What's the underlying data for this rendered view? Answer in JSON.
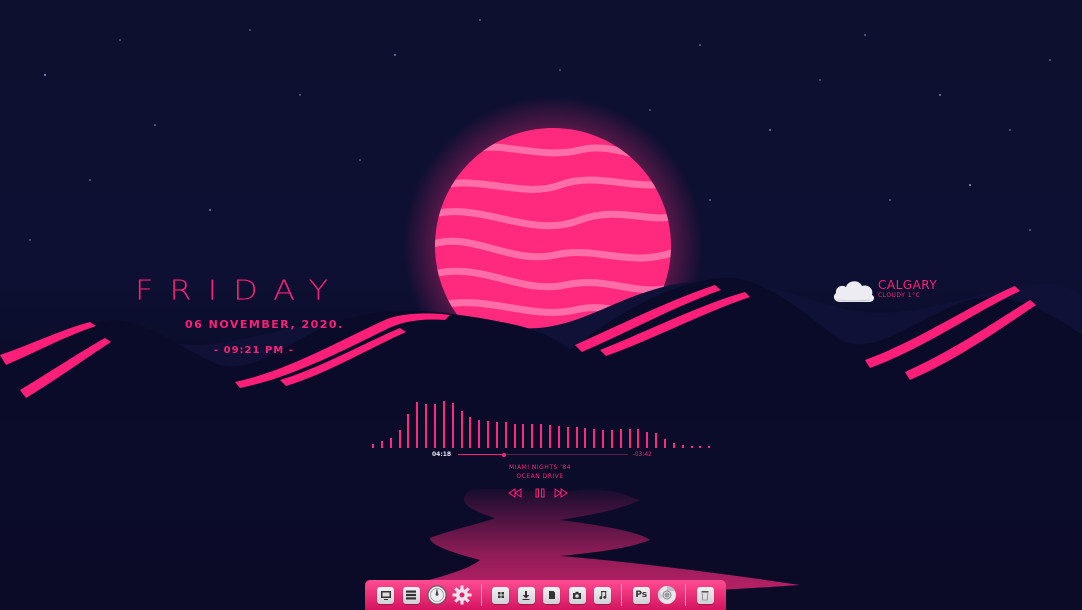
{
  "clock": {
    "day": "FRIDAY",
    "date": "06 NOVEMBER, 2020.",
    "time": "- 09:21 PM -"
  },
  "weather": {
    "city": "CALGARY",
    "condition": "CLOUDY 1°C",
    "icon": "cloud-icon"
  },
  "music": {
    "elapsed": "04:18",
    "remaining": "-03:42",
    "progress": 0.27,
    "title": "MIAMI NIGHTS '84",
    "artist": "OCEAN DRIVE",
    "controls": [
      "rewind-icon",
      "pause-icon",
      "fast-forward-icon"
    ],
    "spectrum": [
      0.08,
      0.14,
      0.2,
      0.34,
      0.66,
      0.88,
      0.84,
      0.84,
      0.9,
      0.86,
      0.72,
      0.6,
      0.54,
      0.52,
      0.5,
      0.5,
      0.46,
      0.46,
      0.46,
      0.46,
      0.44,
      0.42,
      0.4,
      0.4,
      0.38,
      0.36,
      0.34,
      0.34,
      0.36,
      0.36,
      0.36,
      0.3,
      0.28,
      0.18,
      0.1,
      0.06,
      0.04,
      0.04,
      0.04
    ]
  },
  "dock": {
    "groups": [
      [
        "screen-icon",
        "list-icon",
        "compass-icon",
        "gear-icon"
      ],
      [
        "grid-icon",
        "download-icon",
        "document-icon",
        "camera-icon",
        "music-icon"
      ],
      [
        "photoshop-icon",
        "chrome-icon"
      ],
      [
        "trash-icon"
      ]
    ],
    "photoshop_label": "Ps"
  },
  "colors": {
    "accent": "#ff1f78",
    "background": "#0d0f2c",
    "sun": "#ff2a7e",
    "dock": "#e91e6a"
  }
}
